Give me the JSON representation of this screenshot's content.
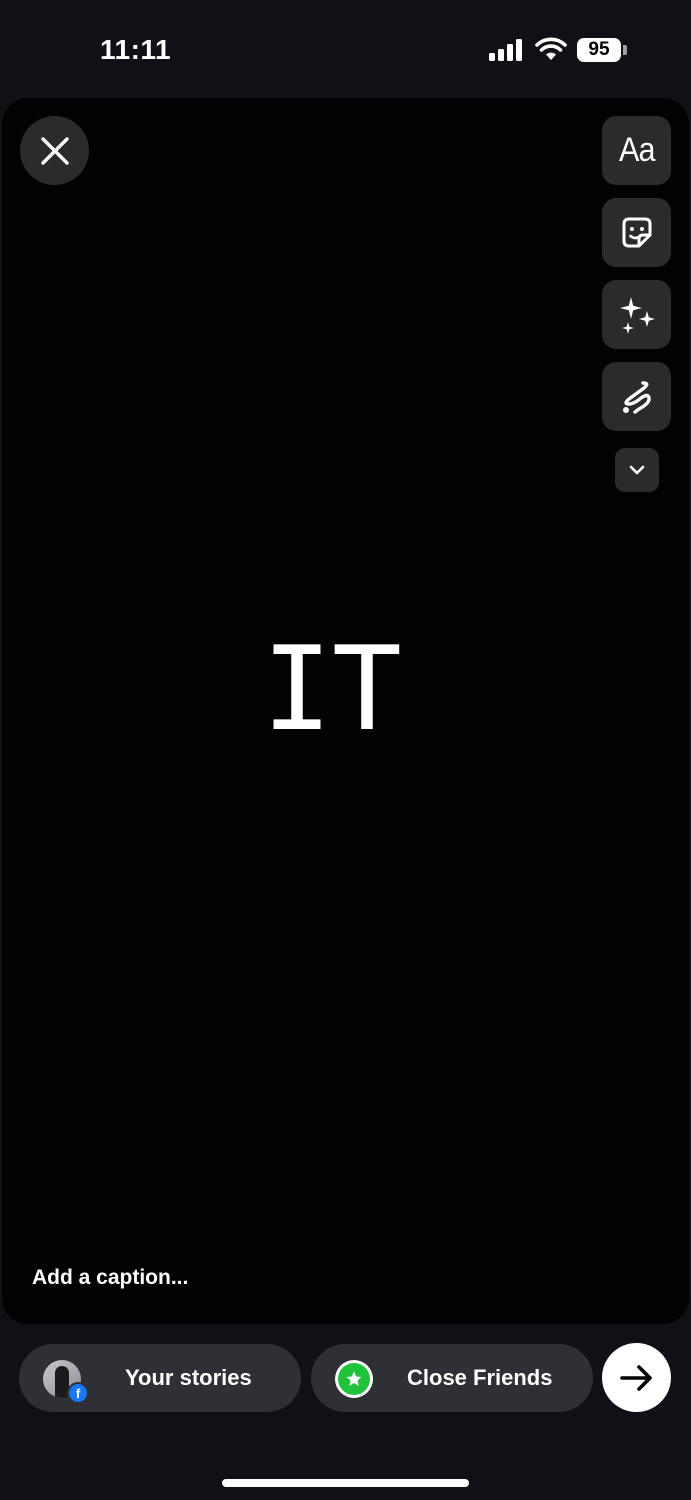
{
  "status_bar": {
    "time": "11:11",
    "battery": "95",
    "icons": [
      "signal-icon",
      "wifi-icon",
      "battery-icon"
    ]
  },
  "editor": {
    "tools": [
      {
        "name": "text-tool",
        "label": "Aa"
      },
      {
        "name": "sticker-tool",
        "icon": "sticker-icon"
      },
      {
        "name": "effects-tool",
        "icon": "sparkles-icon"
      },
      {
        "name": "draw-tool",
        "icon": "scribble-icon"
      }
    ],
    "more_icon": "chevron-down-icon",
    "close_icon": "close-icon",
    "story_text": "IT",
    "caption_placeholder": "Add a caption..."
  },
  "share": {
    "your_stories_label": "Your stories",
    "close_friends_label": "Close Friends",
    "send_icon": "arrow-right-icon",
    "colors": {
      "close_friends": "#21c33d",
      "facebook": "#1877f2"
    }
  }
}
